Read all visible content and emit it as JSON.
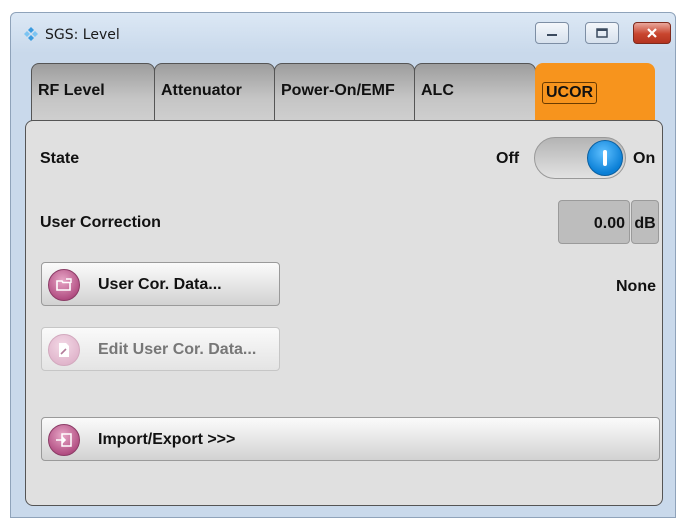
{
  "window": {
    "title": "SGS: Level",
    "controls": [
      "minimize-icon",
      "maximize-icon",
      "close-icon"
    ]
  },
  "tabs": [
    {
      "label": "RF Level",
      "active": false
    },
    {
      "label": "Attenuator",
      "active": false
    },
    {
      "label": "Power-On/EMF",
      "active": false
    },
    {
      "label": "ALC",
      "active": false
    },
    {
      "label": "UCOR",
      "active": true
    }
  ],
  "state": {
    "label": "State",
    "off_label": "Off",
    "on_label": "On",
    "value": "On"
  },
  "user_correction": {
    "label": "User Correction",
    "value": "0.00",
    "unit": "dB"
  },
  "buttons": {
    "user_cor_data": {
      "label": "User Cor. Data...",
      "icon": "folder-open-icon"
    },
    "edit_user_cor_data": {
      "label": "Edit User Cor. Data...",
      "icon": "edit-document-icon",
      "enabled": false
    },
    "import_export": {
      "label": "Import/Export >>>",
      "icon": "import-export-icon"
    }
  },
  "selected_file": "None",
  "colors": {
    "active_tab": "#f7941d",
    "toggle_knob": "#0a7fd6",
    "button_icon": "#b04b80"
  }
}
